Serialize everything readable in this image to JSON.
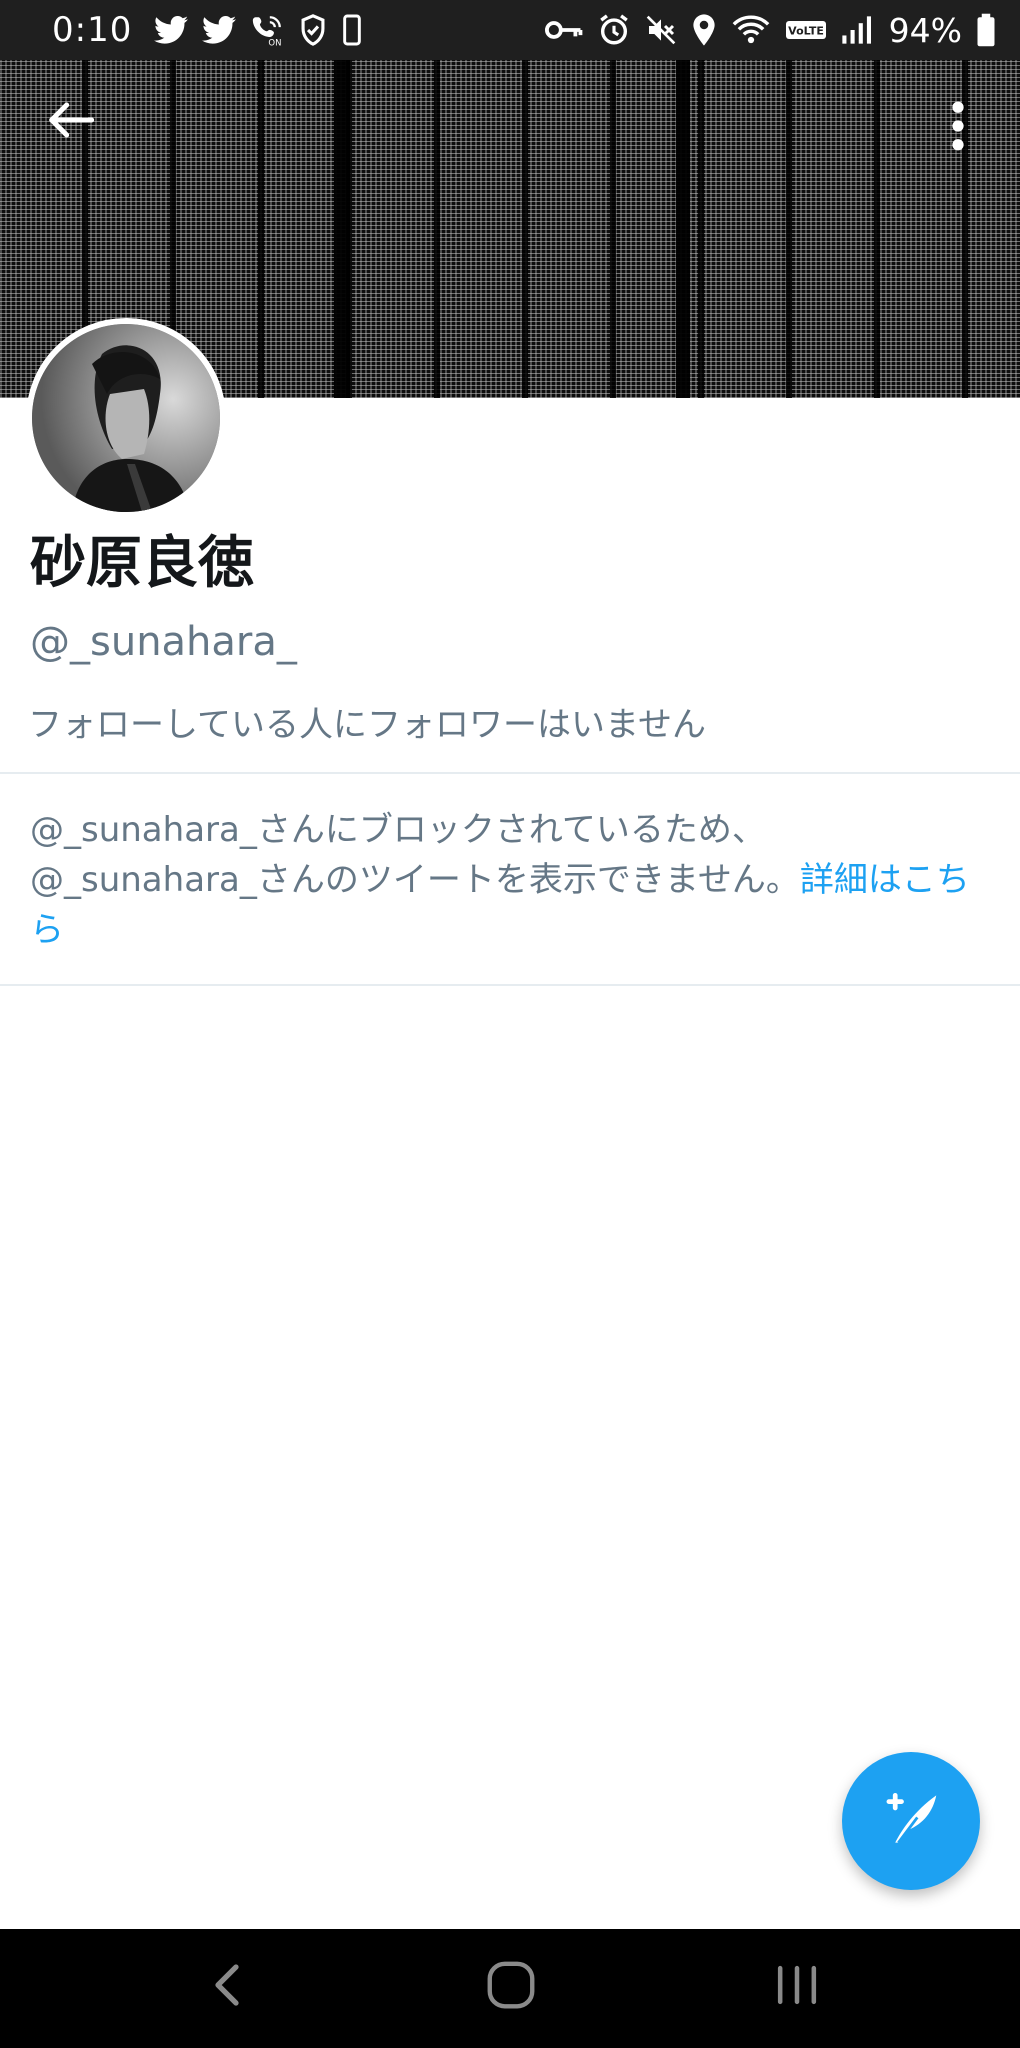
{
  "status_bar": {
    "time": "0:10",
    "battery_percent": "94%",
    "left_icons": [
      "twitter-icon",
      "twitter-icon",
      "wifi-calling-icon",
      "shield-icon",
      "phone-icon"
    ],
    "right_icons": [
      "key-icon",
      "alarm-icon",
      "mute-icon",
      "location-icon",
      "wifi-icon",
      "volte-icon",
      "signal-icon",
      "battery-icon"
    ],
    "volte_label": "VoLTE"
  },
  "header": {
    "back_icon": "arrow-left-icon",
    "more_icon": "more-vertical-icon"
  },
  "profile": {
    "display_name": "砂原良徳",
    "handle": "@_sunahara_",
    "followers_note": "フォローしている人にフォロワーはいません"
  },
  "blocked": {
    "message_line1": "@_sunahara_さんにブロックされているため、",
    "message_line2": "@_sunahara_さんのツイートを表示できません。",
    "link_text": "詳細はこちら"
  },
  "compose": {
    "icon": "compose-tweet-icon"
  },
  "nav": {
    "back_icon": "nav-back-icon",
    "home_icon": "nav-home-icon",
    "recents_icon": "nav-recents-icon"
  },
  "colors": {
    "accent": "#1da1f2",
    "secondary_text": "#657786",
    "divider": "#e6ecf0"
  }
}
